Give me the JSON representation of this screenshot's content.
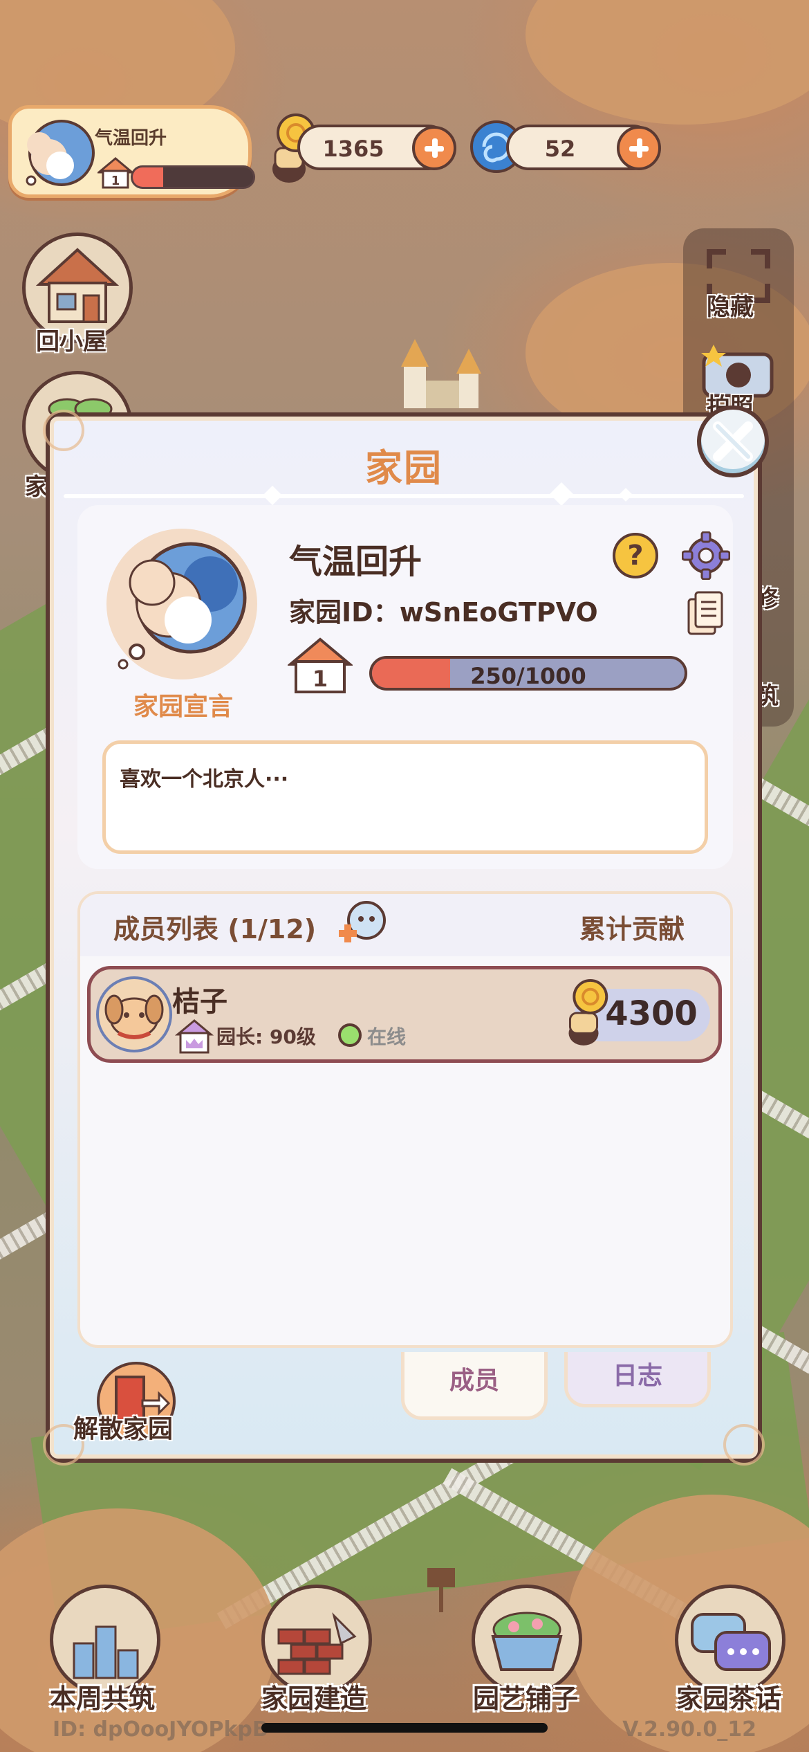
{
  "top_bar": {
    "home_name": "气温回升",
    "home_level": "1",
    "home_progress": 0.25,
    "snail_coins": "1365",
    "swirl_gems": "52"
  },
  "side_left": {
    "back_home_label": "回小屋",
    "home_partial_label": "家"
  },
  "side_right": {
    "hide_label": "隐藏",
    "photo_label": "拍照",
    "repair_partial": "修",
    "build_partial": "筑"
  },
  "modal": {
    "title": "家园",
    "home_name": "气温回升",
    "home_id_label": "家园ID：",
    "home_id_value": "wSnEoGTPVO",
    "help_glyph": "?",
    "level": "1",
    "progress_text": "250/1000",
    "progress_fraction": 0.25,
    "declaration_label": "家园宣言",
    "declaration_text": "喜欢一个北京人···",
    "members_header": "成员列表 (1/12)",
    "contribution_header": "累计贡献",
    "members": [
      {
        "name": "桔子",
        "role": "园长: 90级",
        "status": "在线",
        "contribution": "4300"
      }
    ],
    "tab_members": "成员",
    "tab_log": "日志",
    "disband_label": "解散家园"
  },
  "bottom_nav": {
    "weekly_label": "本周共筑",
    "build_label": "家园建造",
    "garden_shop_label": "园艺铺子",
    "chat_label": "家园茶话"
  },
  "footer": {
    "user_id": "ID: dpOooJYOPkpB",
    "version": "V.2.90.0_12"
  },
  "colors": {
    "accent_orange": "#e08a4a",
    "outline_brown": "#5b3a33",
    "progress_red": "#ea6a56",
    "online_green": "#9adf6e"
  }
}
